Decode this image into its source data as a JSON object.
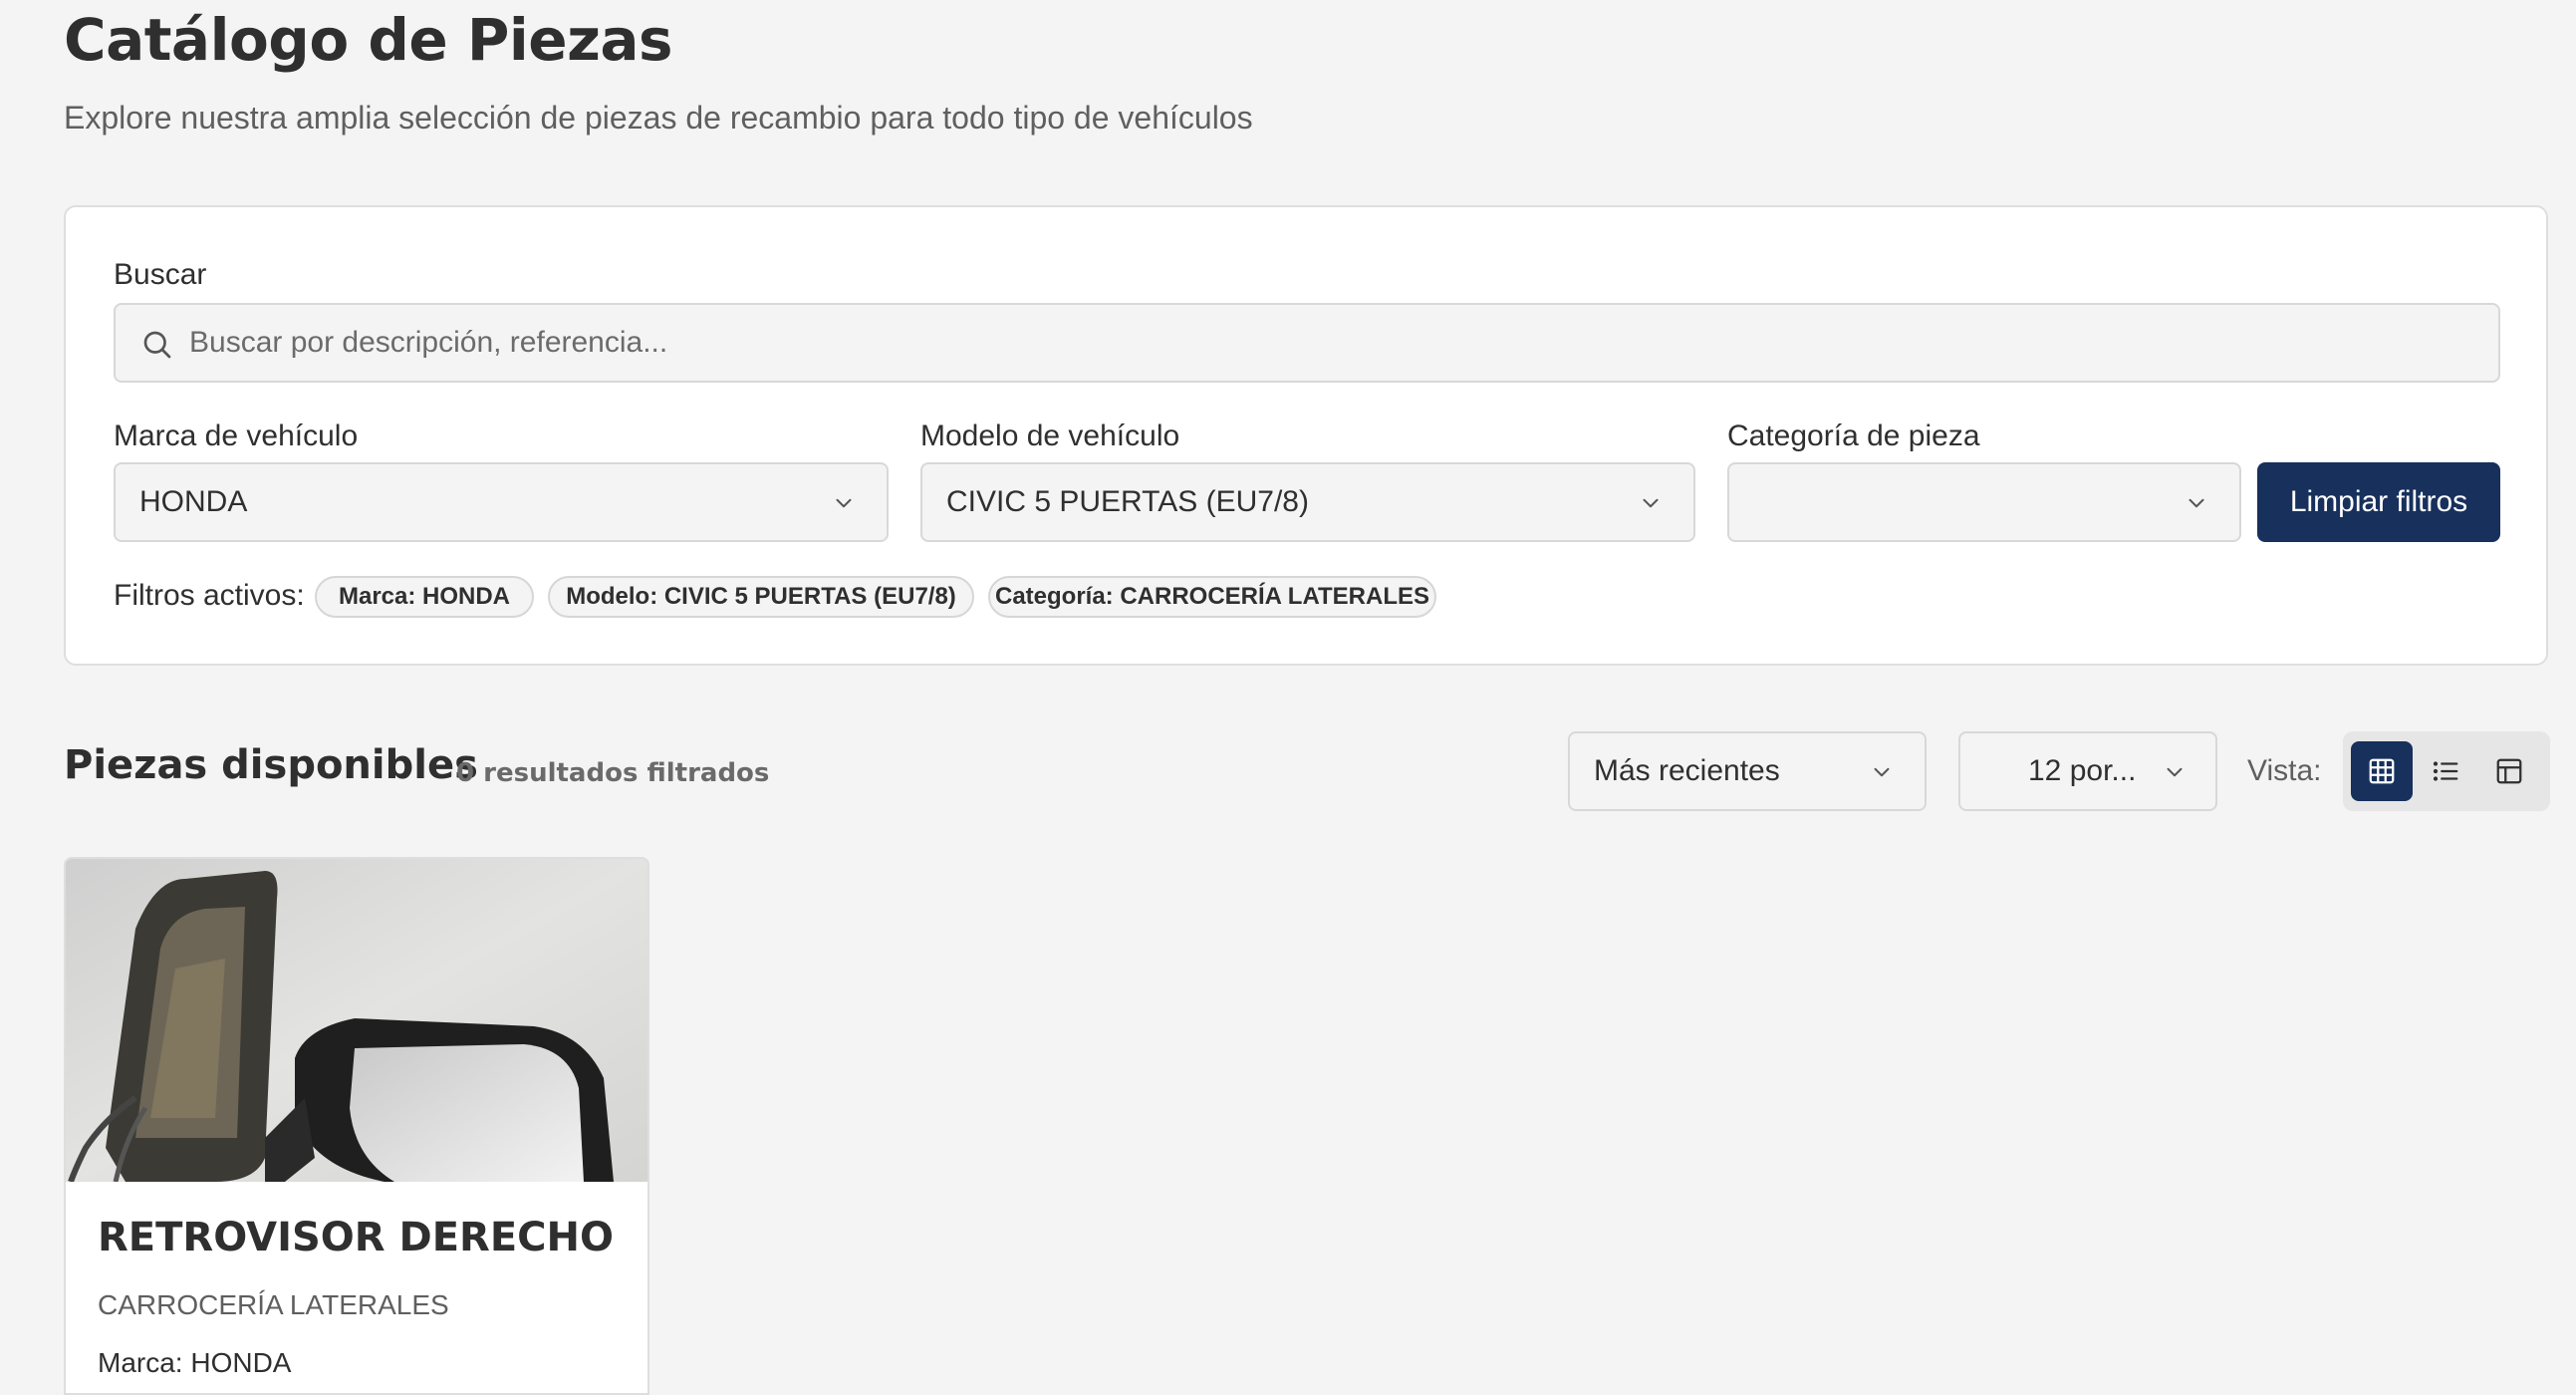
{
  "header": {
    "title": "Catálogo de Piezas",
    "subtitle": "Explore nuestra amplia selección de piezas de recambio para todo tipo de vehículos"
  },
  "filters": {
    "search_label": "Buscar",
    "search_placeholder": "Buscar por descripción, referencia...",
    "search_value": "",
    "brand_label": "Marca de vehículo",
    "brand_value": "HONDA",
    "model_label": "Modelo de vehículo",
    "model_value": "CIVIC 5 PUERTAS (EU7/8)",
    "category_label": "Categoría de pieza",
    "category_value": "",
    "clear_label": "Limpiar filtros",
    "active_label": "Filtros activos:",
    "chips": [
      "Marca: HONDA",
      "Modelo: CIVIC 5 PUERTAS (EU7/8)",
      "Categoría: CARROCERÍA LATERALES"
    ]
  },
  "results": {
    "title": "Piezas disponibles",
    "count_text": "0 resultados filtrados",
    "sort_value": "Más recientes",
    "per_page_value": "12 por...",
    "view_label": "Vista:",
    "views": [
      {
        "icon": "grid-icon",
        "active": true
      },
      {
        "icon": "list-icon",
        "active": false
      },
      {
        "icon": "table-icon",
        "active": false
      }
    ]
  },
  "products": [
    {
      "name": "RETROVISOR DERECHO",
      "category": "CARROCERÍA LATERALES",
      "brand": "Marca: HONDA"
    }
  ],
  "colors": {
    "primary": "#17305c",
    "background": "#f4f4f4",
    "card": "#ffffff",
    "border": "#dedede"
  }
}
